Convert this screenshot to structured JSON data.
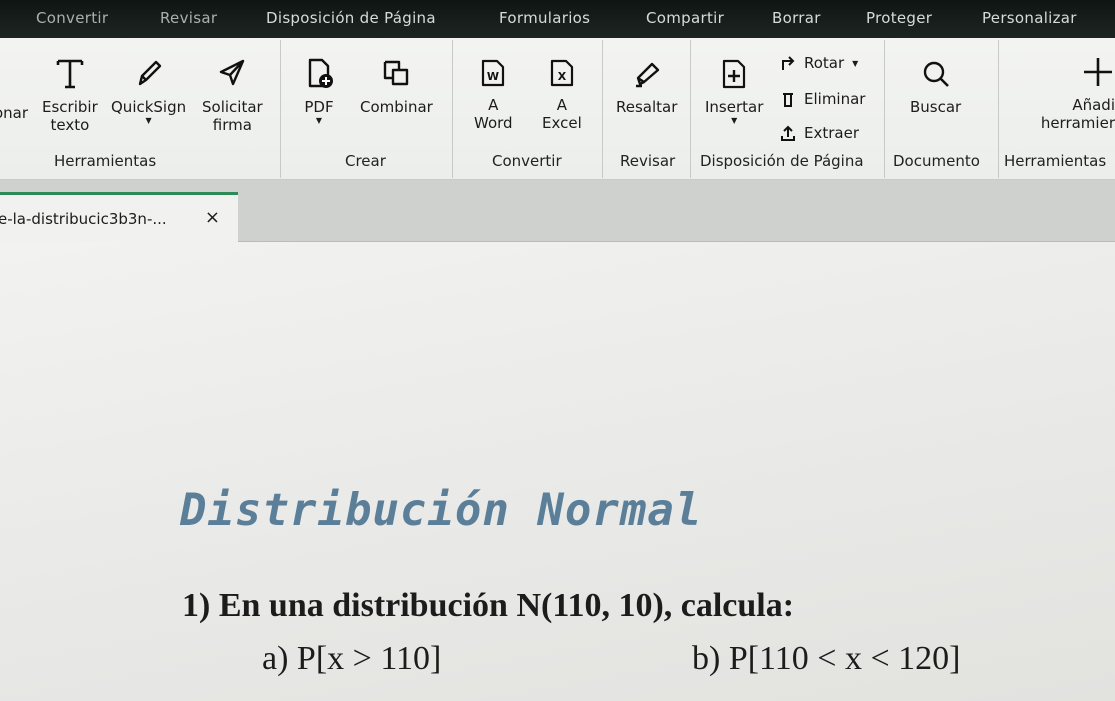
{
  "menu": [
    "Convertir",
    "Revisar",
    "Disposición de Página",
    "Formularios",
    "Compartir",
    "Borrar",
    "Proteger",
    "Personalizar"
  ],
  "ribbon": {
    "tools": {
      "onar": "onar",
      "escribir_l1": "Escribir",
      "escribir_l2": "texto",
      "quicksign": "QuickSign",
      "solicitar_l1": "Solicitar",
      "solicitar_l2": "firma",
      "pdf": "PDF",
      "combinar": "Combinar",
      "word_l1": "A",
      "word_l2": "Word",
      "excel_l1": "A",
      "excel_l2": "Excel",
      "resaltar": "Resaltar",
      "insertar": "Insertar",
      "rotar": "Rotar",
      "eliminar": "Eliminar",
      "extraer": "Extraer",
      "buscar": "Buscar",
      "anadir_l1": "Añadi",
      "anadir_l2": "herramier"
    },
    "groups": {
      "herramientas": "Herramientas",
      "crear": "Crear",
      "convertir": "Convertir",
      "revisar": "Revisar",
      "disposicion": "Disposición de Página",
      "documento": "Documento",
      "herramientas2": "Herramientas"
    }
  },
  "tab": {
    "name": "e-la-distribucic3b3n-...",
    "close": "×"
  },
  "document": {
    "title": "Distribución Normal",
    "q1": "1)  En una distribución N(110, 10), calcula:",
    "qa": "a) P[x > 110]",
    "qb": "b) P[110 < x < 120]"
  },
  "colors": {
    "menubar": "#1a211f",
    "title": "#5c7f99",
    "active_tab_accent": "#2e8b57"
  }
}
